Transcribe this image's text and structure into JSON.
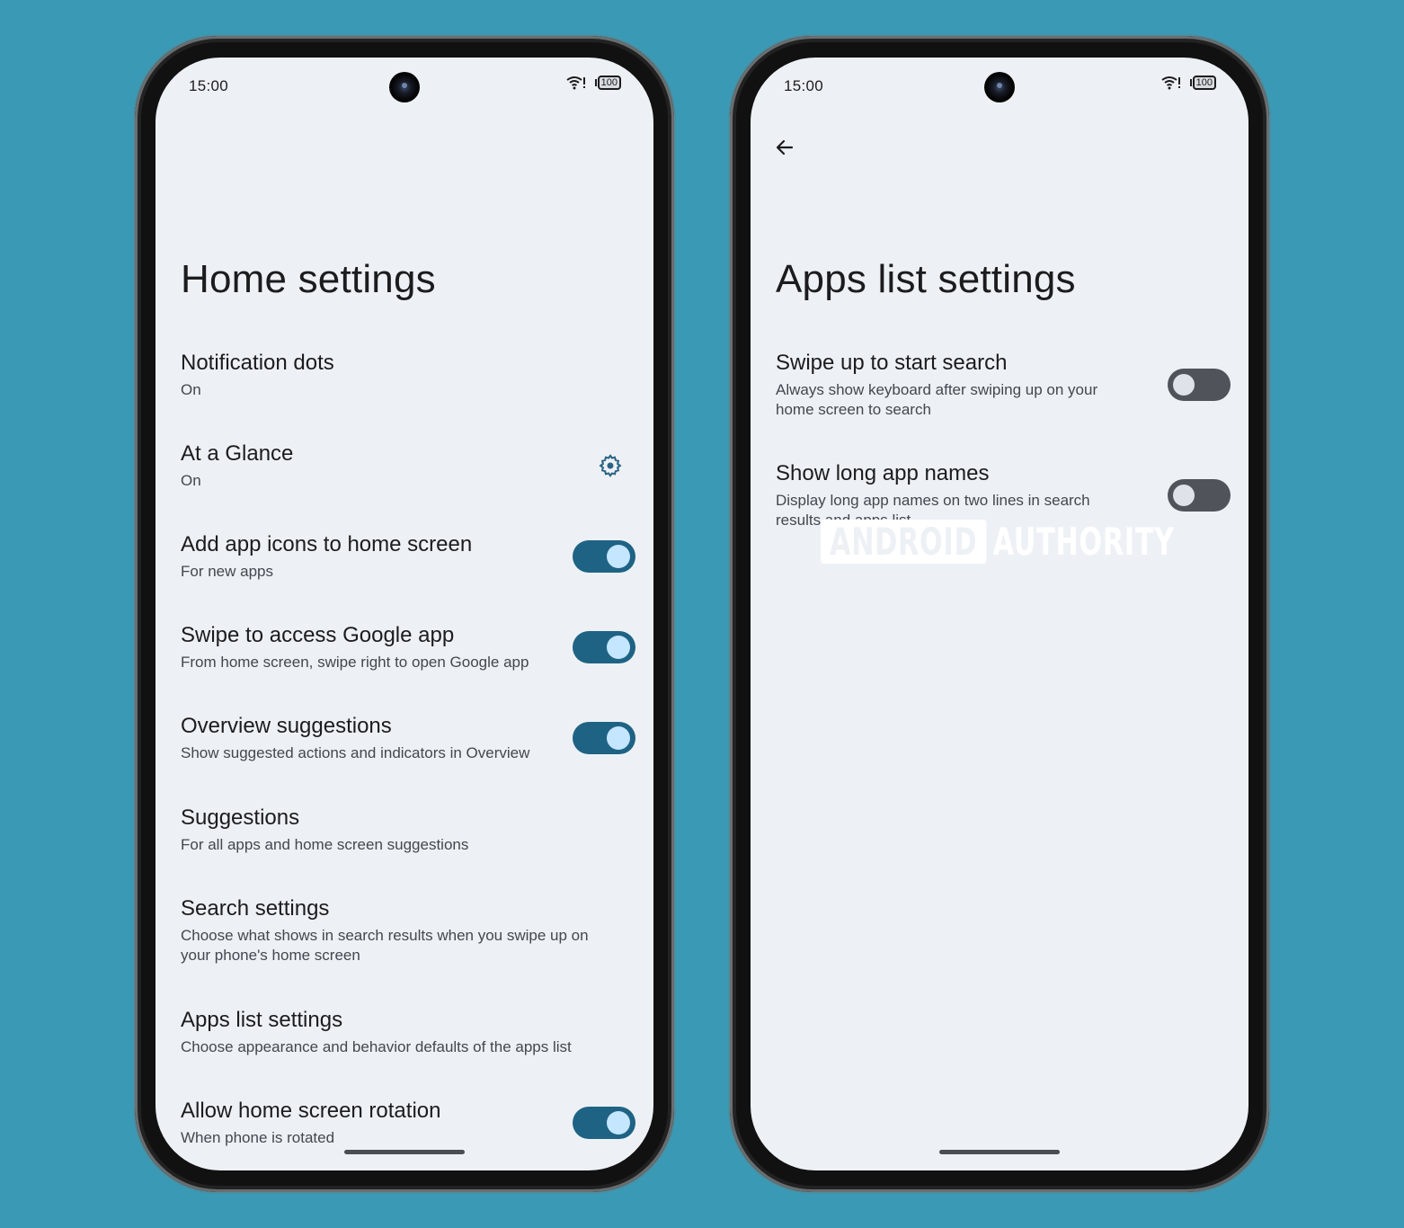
{
  "colors": {
    "background": "#3a9ab5",
    "screen": "#edf1f5",
    "switch_on_track": "#1f6384",
    "switch_on_thumb": "#c4e6ff",
    "switch_off_track": "#50545a",
    "switch_off_thumb": "#dfe2e8",
    "accent_icon": "#2a6485"
  },
  "left_phone": {
    "status_bar": {
      "time": "15:00",
      "battery": "100",
      "wifi_icon": "wifi-alert-icon"
    },
    "title": "Home settings",
    "items": [
      {
        "title": "Notification dots",
        "summary": "On",
        "control": "none"
      },
      {
        "title": "At a Glance",
        "summary": "On",
        "control": "gear",
        "icon": "gear-icon"
      },
      {
        "title": "Add app icons to home screen",
        "summary": "For new apps",
        "control": "switch",
        "checked": true
      },
      {
        "title": "Swipe to access Google app",
        "summary": "From home screen, swipe right to open Google app",
        "control": "switch",
        "checked": true
      },
      {
        "title": "Overview suggestions",
        "summary": "Show suggested actions and indicators in Overview",
        "control": "switch",
        "checked": true
      },
      {
        "title": "Suggestions",
        "summary": "For all apps and home screen suggestions",
        "control": "none"
      },
      {
        "title": "Search settings",
        "summary": "Choose what shows in search results when you swipe up on your phone's home screen",
        "control": "none"
      },
      {
        "title": "Apps list settings",
        "summary": "Choose appearance and behavior defaults of the apps list",
        "control": "none"
      },
      {
        "title": "Allow home screen rotation",
        "summary": "When phone is rotated",
        "control": "switch",
        "checked": true
      }
    ]
  },
  "right_phone": {
    "status_bar": {
      "time": "15:00",
      "battery": "100",
      "wifi_icon": "wifi-alert-icon"
    },
    "back_icon": "arrow-back-icon",
    "title": "Apps list settings",
    "items": [
      {
        "title": "Swipe up to start search",
        "summary": "Always show keyboard after swiping up on your home screen to search",
        "control": "switch",
        "checked": false
      },
      {
        "title": "Show long app names",
        "summary": "Display long app names on two lines in search results and apps list",
        "control": "switch",
        "checked": false
      }
    ],
    "watermark": {
      "part1": "ANDROID",
      "part2": "AUTHORITY"
    }
  }
}
